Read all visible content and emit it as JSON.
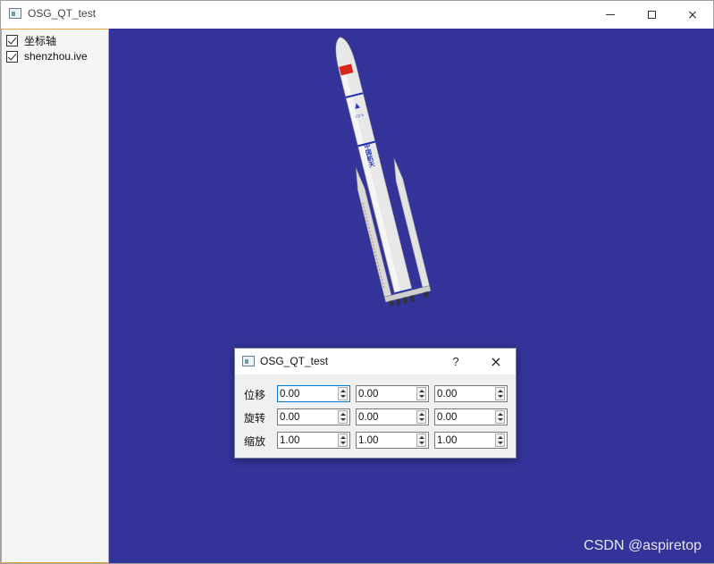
{
  "window": {
    "title": "OSG_QT_test",
    "minimize_glyph": "minimize-icon",
    "maximize_glyph": "maximize-icon",
    "close_glyph": "×"
  },
  "sidebar": {
    "items": [
      {
        "label": "坐标轴",
        "checked": true
      },
      {
        "label": "shenzhou.ive",
        "checked": true
      }
    ]
  },
  "viewport": {
    "background": "#333399",
    "rocket_text": "中国航天",
    "watermark": "CSDN @aspiretop"
  },
  "dialog": {
    "title": "OSG_QT_test",
    "help_label": "?",
    "close_label": "×",
    "rows": [
      {
        "label": "位移",
        "values": [
          "0.00",
          "0.00",
          "0.00"
        ]
      },
      {
        "label": "旋转",
        "values": [
          "0.00",
          "0.00",
          "0.00"
        ]
      },
      {
        "label": "缩放",
        "values": [
          "1.00",
          "1.00",
          "1.00"
        ]
      }
    ]
  }
}
